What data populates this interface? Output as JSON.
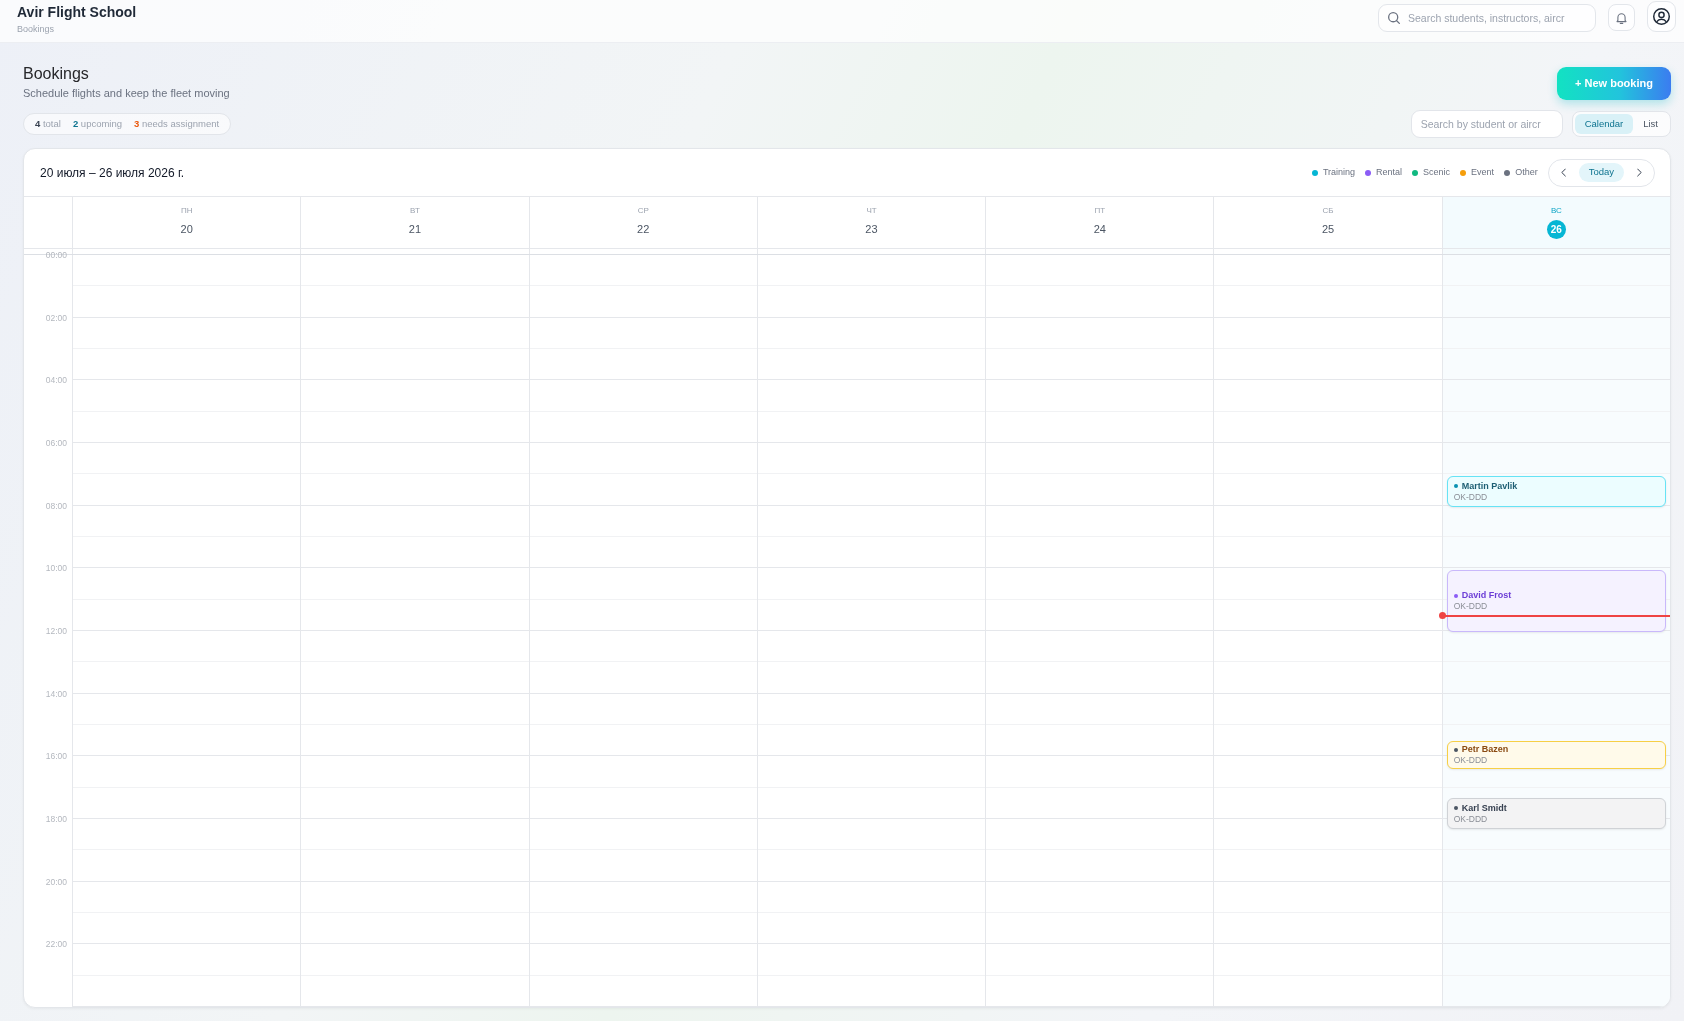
{
  "app": {
    "title": "Avir Flight School",
    "subtitle": "Bookings"
  },
  "global_search": {
    "placeholder": "Search students, instructors, aircr"
  },
  "page": {
    "title": "Bookings",
    "subtitle": "Schedule flights and keep the fleet moving"
  },
  "new_booking_button": "+ New booking",
  "stats": [
    {
      "count": "4",
      "caption": "total",
      "color": "#374151"
    },
    {
      "count": "2",
      "caption": "upcoming",
      "color": "#0e7490"
    },
    {
      "count": "3",
      "caption": "needs assignment",
      "color": "#ea580c"
    }
  ],
  "booking_search": {
    "placeholder": "Search by student or aircr"
  },
  "view_toggle": [
    {
      "label": "Calendar",
      "selected": true
    },
    {
      "label": "List",
      "selected": false
    }
  ],
  "calendar": {
    "range_title": "20 июля – 26 июля 2026 г.",
    "legend": [
      {
        "label": "Training",
        "color": "#06b6d4"
      },
      {
        "label": "Rental",
        "color": "#8b5cf6"
      },
      {
        "label": "Scenic",
        "color": "#10b981"
      },
      {
        "label": "Event",
        "color": "#f59e0b"
      },
      {
        "label": "Other",
        "color": "#6b7280"
      }
    ],
    "today_button": "Today",
    "days": [
      {
        "weekday": "ПН",
        "date": "20",
        "today": false
      },
      {
        "weekday": "ВТ",
        "date": "21",
        "today": false
      },
      {
        "weekday": "СР",
        "date": "22",
        "today": false
      },
      {
        "weekday": "ЧТ",
        "date": "23",
        "today": false
      },
      {
        "weekday": "ПТ",
        "date": "24",
        "today": false
      },
      {
        "weekday": "СБ",
        "date": "25",
        "today": false
      },
      {
        "weekday": "ВС",
        "date": "26",
        "today": true,
        "bookings": [
          {
            "kind": "training",
            "name": "Martin Pavlik",
            "aircraft": "OK-DDD",
            "color": "#0891b2"
          },
          {
            "kind": "rental",
            "name": "David Frost",
            "aircraft": "OK-DDD",
            "color": "#8b5cf6"
          },
          {
            "kind": "event",
            "name": "Petr Bazen",
            "aircraft": "OK-DDD",
            "color": "#4b5563"
          },
          {
            "kind": "other",
            "name": "Karl Smidt",
            "aircraft": "OK-DDD",
            "color": "#4b5563"
          }
        ]
      }
    ],
    "time_labels": [
      "00:00",
      "02:00",
      "04:00",
      "06:00",
      "08:00",
      "10:00",
      "12:00",
      "14:00",
      "16:00",
      "18:00",
      "20:00",
      "22:00"
    ]
  }
}
